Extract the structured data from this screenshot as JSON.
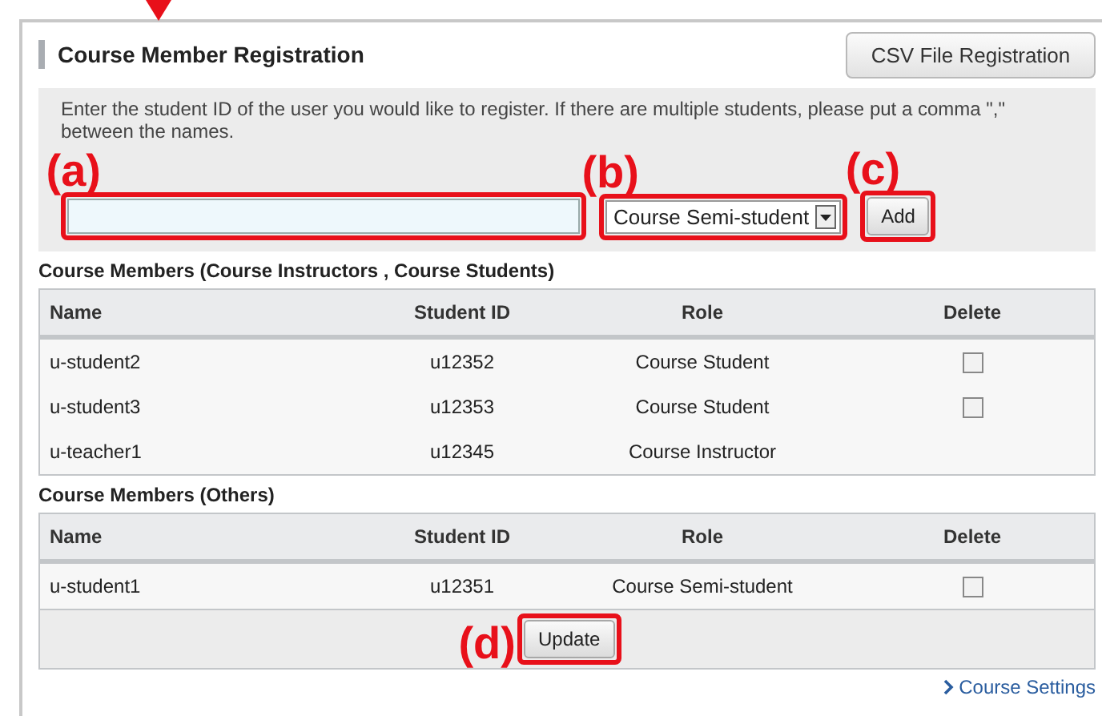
{
  "title": "Course Member Registration",
  "csv_button": "CSV File Registration",
  "add_form": {
    "instructions": "Enter the student ID of the user you would like to register. If there are multiple students, please put a comma \",\" between the names.",
    "student_id": {
      "annotation": "(a)"
    },
    "role_select": {
      "value": "Course Semi-student",
      "annotation": "(b)"
    },
    "add_button": {
      "label": "Add",
      "annotation": "(c)"
    }
  },
  "tables": [
    {
      "heading": "Course Members (Course Instructors , Course Students)",
      "columns": [
        "Name",
        "Student ID",
        "Role",
        "Delete"
      ],
      "rows": [
        {
          "name": "u-student2",
          "student_id": "u12352",
          "role": "Course Student",
          "deletable": true,
          "checked": false
        },
        {
          "name": "u-student3",
          "student_id": "u12353",
          "role": "Course Student",
          "deletable": true,
          "checked": false
        },
        {
          "name": "u-teacher1",
          "student_id": "u12345",
          "role": "Course Instructor",
          "deletable": false
        }
      ]
    },
    {
      "heading": "Course Members (Others)",
      "columns": [
        "Name",
        "Student ID",
        "Role",
        "Delete"
      ],
      "rows": [
        {
          "name": "u-student1",
          "student_id": "u12351",
          "role": "Course Semi-student",
          "deletable": true,
          "checked": false
        }
      ]
    }
  ],
  "update_button": {
    "label": "Update",
    "annotation": "(d)"
  },
  "footer_link": "Course Settings"
}
